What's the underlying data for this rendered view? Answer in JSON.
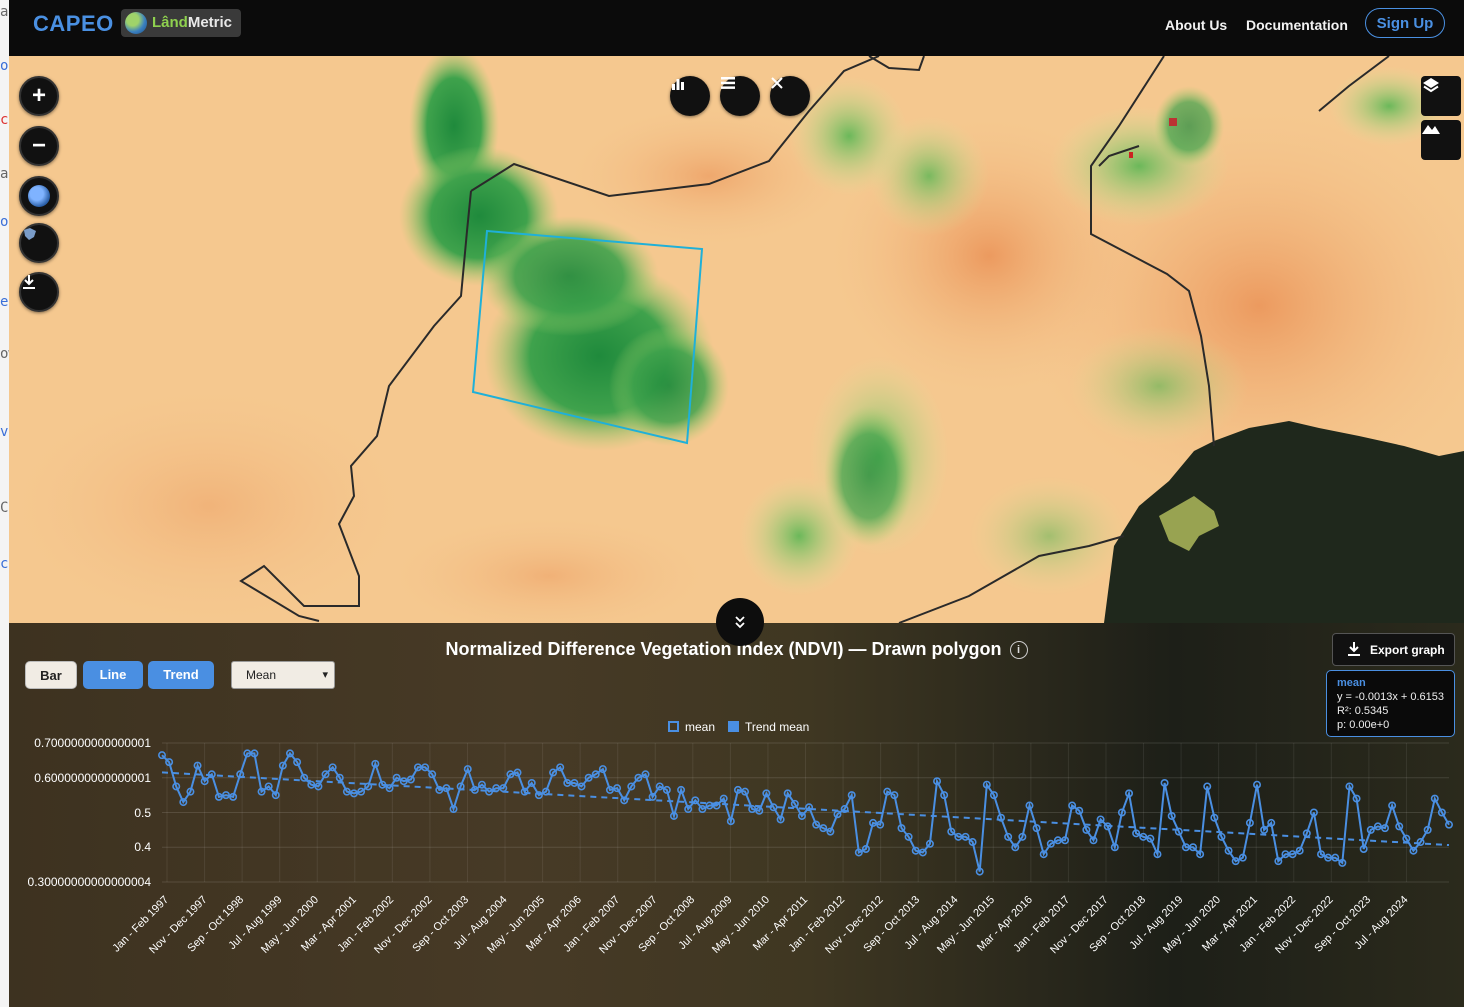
{
  "header": {
    "brand": "CAPEO",
    "partner_prefix": "Lând",
    "partner_suffix": "Metric",
    "nav": [
      "About Us",
      "Documentation"
    ],
    "signup": "Sign Up"
  },
  "map_controls": {
    "left": [
      "zoom-in",
      "zoom-out",
      "basemap-globe",
      "region-select",
      "download"
    ],
    "top": [
      "chart",
      "list",
      "close"
    ],
    "right": [
      "layers",
      "terrain"
    ]
  },
  "chart_panel": {
    "title": "Normalized Difference Vegetation Index (NDVI) — Drawn polygon",
    "info": "i",
    "buttons": {
      "bar": "Bar",
      "line": "Line",
      "trend": "Trend"
    },
    "select_value": "Mean",
    "export_label": "Export graph",
    "stats": {
      "heading": "mean",
      "equation": "y = -0.0013x + 0.6153",
      "r2": "R²: 0.5345",
      "p": "p: 0.00e+0"
    },
    "legend": {
      "series": "mean",
      "trend": "Trend mean"
    }
  },
  "chart_data": {
    "type": "line",
    "ylim": [
      0.3,
      0.7
    ],
    "y_ticks": [
      "0.7000000000000001",
      "0.6000000000000001",
      "0.5",
      "0.4",
      "0.30000000000000004"
    ],
    "y_tick_values": [
      0.7,
      0.6,
      0.5,
      0.4,
      0.3
    ],
    "x_tick_labels": [
      "Jan - Feb 1997",
      "Nov - Dec 1997",
      "Sep - Oct 1998",
      "Jul - Aug 1999",
      "May - Jun 2000",
      "Mar - Apr 2001",
      "Jan - Feb 2002",
      "Nov - Dec 2002",
      "Sep - Oct 2003",
      "Jul - Aug 2004",
      "May - Jun 2005",
      "Mar - Apr 2006",
      "Jan - Feb 2007",
      "Nov - Dec 2007",
      "Sep - Oct 2008",
      "Jul - Aug 2009",
      "May - Jun 2010",
      "Mar - Apr 2011",
      "Jan - Feb 2012",
      "Nov - Dec 2012",
      "Sep - Oct 2013",
      "Jul - Aug 2014",
      "May - Jun 2015",
      "Mar - Apr 2016",
      "Jan - Feb 2017",
      "Nov - Dec 2017",
      "Sep - Oct 2018",
      "Jul - Aug 2019",
      "May - Jun 2020",
      "Mar - Apr 2021",
      "Jan - Feb 2022",
      "Nov - Dec 2022",
      "Sep - Oct 2023",
      "Jul - Aug 2024"
    ],
    "series": [
      {
        "name": "mean",
        "color": "#4a8fe2",
        "values": [
          0.665,
          0.645,
          0.575,
          0.53,
          0.56,
          0.635,
          0.59,
          0.61,
          0.545,
          0.55,
          0.545,
          0.61,
          0.67,
          0.67,
          0.56,
          0.575,
          0.55,
          0.635,
          0.67,
          0.645,
          0.6,
          0.58,
          0.575,
          0.61,
          0.63,
          0.6,
          0.56,
          0.555,
          0.56,
          0.575,
          0.64,
          0.58,
          0.57,
          0.6,
          0.59,
          0.595,
          0.63,
          0.63,
          0.61,
          0.565,
          0.57,
          0.51,
          0.575,
          0.625,
          0.565,
          0.58,
          0.56,
          0.57,
          0.57,
          0.61,
          0.615,
          0.56,
          0.585,
          0.55,
          0.56,
          0.615,
          0.63,
          0.585,
          0.585,
          0.575,
          0.6,
          0.61,
          0.625,
          0.565,
          0.57,
          0.535,
          0.575,
          0.6,
          0.61,
          0.545,
          0.575,
          0.565,
          0.49,
          0.565,
          0.51,
          0.535,
          0.51,
          0.52,
          0.52,
          0.54,
          0.475,
          0.565,
          0.56,
          0.51,
          0.505,
          0.555,
          0.515,
          0.48,
          0.555,
          0.525,
          0.49,
          0.515,
          0.465,
          0.455,
          0.445,
          0.495,
          0.51,
          0.55,
          0.385,
          0.395,
          0.47,
          0.465,
          0.56,
          0.55,
          0.455,
          0.43,
          0.39,
          0.385,
          0.41,
          0.59,
          0.55,
          0.445,
          0.43,
          0.43,
          0.415,
          0.33,
          0.58,
          0.55,
          0.485,
          0.43,
          0.4,
          0.43,
          0.52,
          0.455,
          0.38,
          0.41,
          0.42,
          0.42,
          0.52,
          0.505,
          0.45,
          0.42,
          0.48,
          0.46,
          0.4,
          0.5,
          0.555,
          0.44,
          0.43,
          0.425,
          0.38,
          0.585,
          0.49,
          0.445,
          0.4,
          0.4,
          0.38,
          0.575,
          0.485,
          0.43,
          0.39,
          0.36,
          0.37,
          0.47,
          0.58,
          0.45,
          0.47,
          0.36,
          0.38,
          0.38,
          0.39,
          0.44,
          0.5,
          0.38,
          0.37,
          0.37,
          0.355,
          0.575,
          0.54,
          0.395,
          0.45,
          0.46,
          0.455,
          0.52,
          0.46,
          0.425,
          0.39,
          0.415,
          0.45,
          0.54,
          0.5,
          0.465
        ]
      },
      {
        "name": "Trend mean",
        "color": "#4a8fe2",
        "values": [
          0.6153,
          0.4063
        ]
      }
    ]
  }
}
